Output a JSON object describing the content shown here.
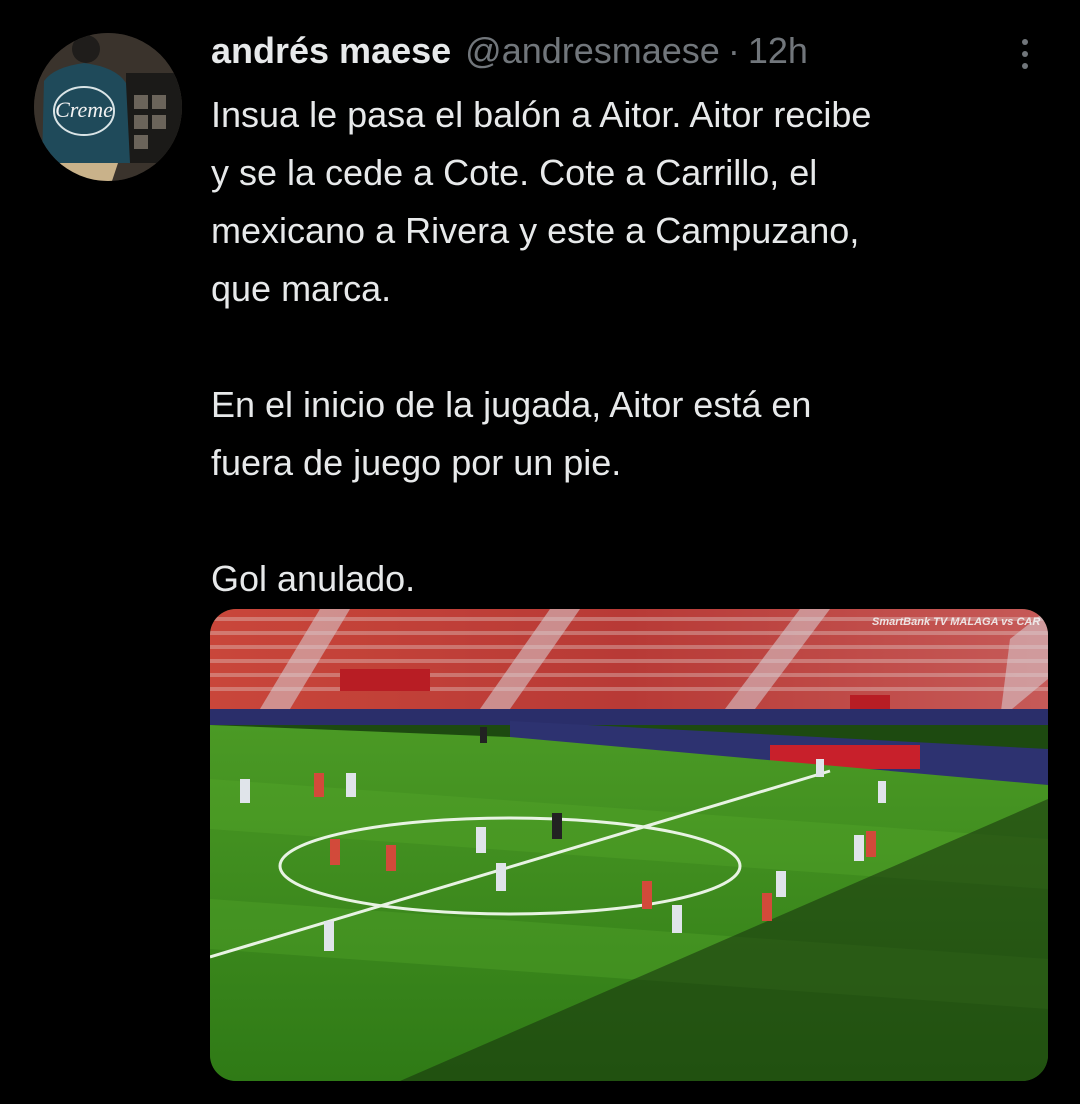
{
  "tweet": {
    "author_name": "andrés maese",
    "handle": "@andresmaese",
    "separator": "·",
    "time": "12h",
    "text": "Insua le pasa el balón a Aitor. Aitor recibe\ny se la cede a Cote. Cote a Carrillo, el\nmexicano a Rivera y este a Campuzano,\nque marca.\n\nEn el inicio de la jugada, Aitor está en\nfuera de juego por un pie.\n\nGol anulado.",
    "more_icon": "more-vertical-icon",
    "avatar_text": "Creme",
    "media": {
      "broadcast_watermark": "SmartBank TV MALAGA vs CAR",
      "description_colors": {
        "pitch": "#3f8f1f",
        "stands": "#c0302c"
      }
    }
  }
}
